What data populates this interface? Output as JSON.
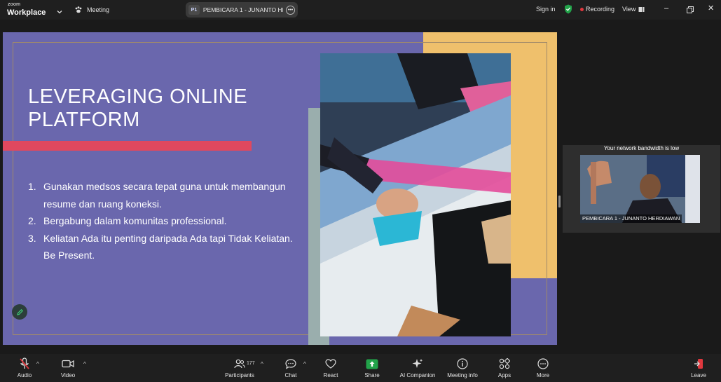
{
  "topbar": {
    "logo_small": "zoom",
    "logo_main": "Workplace",
    "meeting_label": "Meeting",
    "speaker_badge": "P1",
    "speaker_name": "PEMBICARA 1 - JUNANTO HERDIAWAN",
    "signin_label": "Sign in",
    "recording_label": "Recording",
    "view_label": "View"
  },
  "slide": {
    "title_line1": "LEVERAGING ONLINE",
    "title_line2": "PLATFORM",
    "items": [
      {
        "num": "1.",
        "text": "Gunakan medsos secara tepat guna untuk membangun resume dan ruang koneksi."
      },
      {
        "num": "2.",
        "text": "Bergabung dalam komunitas professional."
      },
      {
        "num": "3.",
        "text": "Keliatan Ada itu penting daripada Ada tapi Tidak Keliatan.  Be Present."
      }
    ],
    "colors": {
      "background": "#6a67ad",
      "accent_bar": "#e0485f",
      "accent_block": "#efc06c",
      "teal_strip": "#9aaead"
    }
  },
  "video": {
    "bandwidth_message": "Your network bandwidth is low",
    "participant_name": "PEMBICARA 1 - JUNANTO HERDIAWAN"
  },
  "toolbar": {
    "audio": "Audio",
    "video": "Video",
    "participants": "Participants",
    "participants_count": "177",
    "chat": "Chat",
    "react": "React",
    "share": "Share",
    "ai_companion": "AI Companion",
    "meeting_info": "Meeting info",
    "apps": "Apps",
    "more": "More",
    "leave": "Leave"
  }
}
